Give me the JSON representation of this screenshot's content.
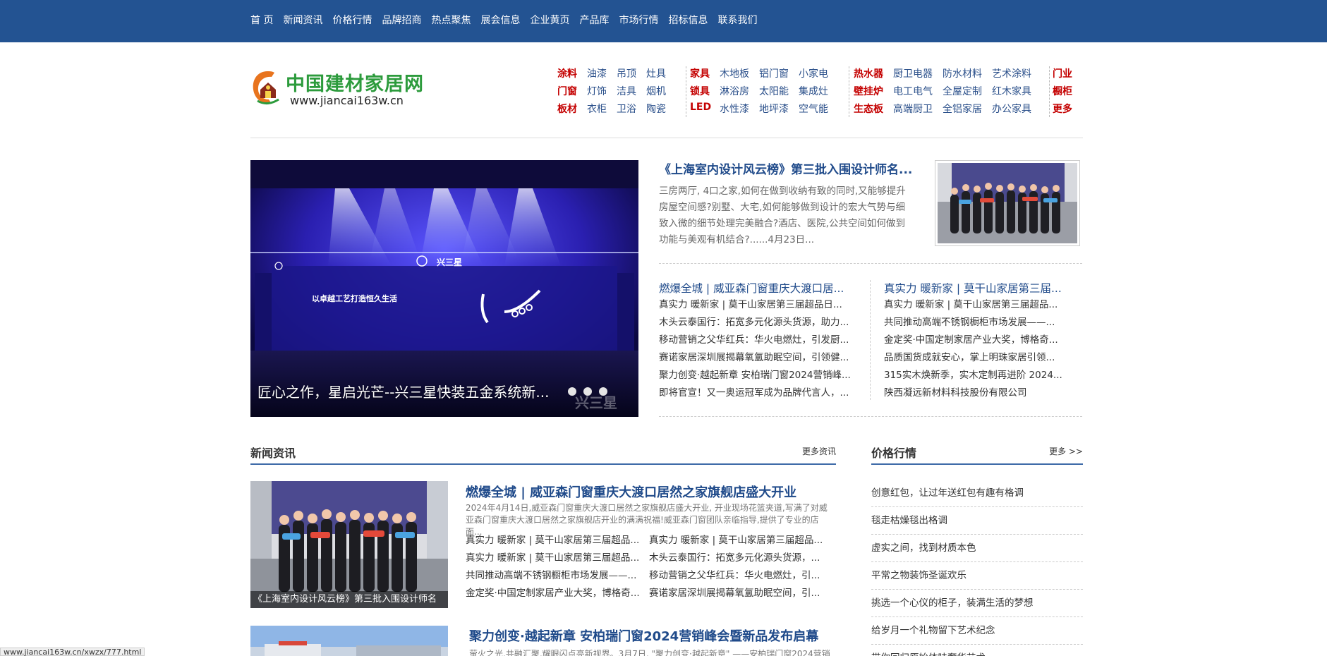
{
  "topnav": {
    "items": [
      "首 页",
      "新闻资讯",
      "价格行情",
      "品牌招商",
      "热点聚焦",
      "展会信息",
      "企业黄页",
      "产品库",
      "市场行情",
      "招标信息",
      "联系我们"
    ]
  },
  "header": {
    "logo_title": "中国建材家居网",
    "logo_url": "www.jiancai163w.cn",
    "categories": [
      [
        [
          "涂料",
          "油漆",
          "吊顶",
          "灶具"
        ],
        [
          "门窗",
          "灯饰",
          "洁具",
          "烟机"
        ],
        [
          "板材",
          "衣柜",
          "卫浴",
          "陶瓷"
        ]
      ],
      [
        [
          "家具",
          "木地板",
          "铝门窗",
          "小家电"
        ],
        [
          "锁具",
          "淋浴房",
          "太阳能",
          "集成灶"
        ],
        [
          "LED",
          "水性漆",
          "地坪漆",
          "空气能"
        ]
      ],
      [
        [
          "热水器",
          "厨卫电器",
          "防水材料",
          "艺术涂料"
        ],
        [
          "壁挂炉",
          "电工电气",
          "全屋定制",
          "红木家具"
        ],
        [
          "生态板",
          "高端厨卫",
          "全铝家居",
          "办公家具"
        ]
      ],
      [
        [
          "门业"
        ],
        [
          "橱柜"
        ],
        [
          "更多"
        ]
      ]
    ]
  },
  "hero": {
    "caption": "匠心之作，星启光芒--兴三星快装五金系统新...",
    "screen_text": "以卓越工艺打造恒久生活",
    "brand_text": "兴三星",
    "slide_count": 3
  },
  "headline": {
    "title": "《上海室内设计风云榜》第三批入围设计师名...",
    "description": "三房两厅, 4口之家,如何在做到收纳有致的同时,又能够提升房屋空间感?别墅、大宅,如何能够做到设计的宏大气势与细致入微的细节处理完美融合?酒店、医院,公共空间如何做到功能与美观有机结合?......4月23日..."
  },
  "news_left": {
    "title": "燃爆全城 | 威亚森门窗重庆大渡口居...",
    "items": [
      "真实力 暖新家 | 莫干山家居第三届超品日...",
      "木头云泰国行：拓宽多元化源头货源，助力...",
      "移动营销之父华红兵：华火电燃灶，引发厨...",
      "赛诺家居深圳展揭幕氧氲助眠空间，引领健...",
      "聚力创变·越起新章 安柏瑞门窗2024营销峰...",
      "即将官宣！又一奥运冠军成为品牌代言人，..."
    ]
  },
  "news_right": {
    "title": "真实力 暖新家 | 莫干山家居第三届...",
    "items": [
      "真实力 暖新家 | 莫干山家居第三届超品...",
      "共同推动高端不锈钢橱柜市场发展——...",
      "金定奖·中国定制家居产业大奖，博格奇...",
      "品质国货成就安心，掌上明珠家居引领...",
      "315实木焕新季，实木定制再进阶 2024...",
      "陕西凝远新材料科技股份有限公司"
    ]
  },
  "news_section": {
    "title": "新闻资讯",
    "more": "更多资讯",
    "thumb_caption": "《上海室内设计风云榜》第三批入围设计师名",
    "feature_title": "燃爆全城 | 威亚森门窗重庆大渡口居然之家旗舰店盛大开业",
    "feature_desc": "2024年4月14日,威亚森门窗重庆大渡口居然之家旗舰店盛大开业, 开业现场花篮夹道,写满了对威亚森门窗重庆大渡口居然之家旗舰店开业的满满祝福!威亚森门窗团队亲临指导,提供了专业的店面...",
    "pairs": [
      [
        "真实力 暖新家 | 莫干山家居第三届超品...",
        "真实力 暖新家 | 莫干山家居第三届超品..."
      ],
      [
        "真实力 暖新家 | 莫干山家居第三届超品...",
        "木头云泰国行：拓宽多元化源头货源，..."
      ],
      [
        "共同推动高端不锈钢橱柜市场发展——...",
        "移动营销之父华红兵：华火电燃灶，引..."
      ],
      [
        "金定奖·中国定制家居产业大奖，博格奇...",
        "赛诺家居深圳展揭幕氧氲助眠空间，引..."
      ]
    ],
    "feature2_title": "聚力创变·越起新章 安柏瑞门窗2024营销峰会暨新品发布启幕",
    "feature2_desc": "萤火之光,共融汇聚,耀眼闪点亮新视界。3月7日, \"聚力创变·越起新章\" ——安柏瑞门窗2024营销"
  },
  "price_section": {
    "title": "价格行情",
    "more": "更多 >>",
    "items": [
      "创意红包，让过年送红包有趣有格调",
      "毯走枯燥毯出格调",
      "虚实之间，找到材质本色",
      "平常之物装饰圣诞欢乐",
      "挑选一个心仪的柜子，装满生活的梦想",
      "给岁月一个礼物留下艺术纪念",
      "带你回归原始体味奢华艺术"
    ]
  },
  "status_bar": {
    "url": "www.jiancai163w.cn/xwzx/777.html"
  },
  "colors": {
    "topnav_bg": "#235392",
    "logo_green": "#2c9b3c",
    "category_red": "#c40000",
    "link_blue": "#1f4a8a"
  }
}
